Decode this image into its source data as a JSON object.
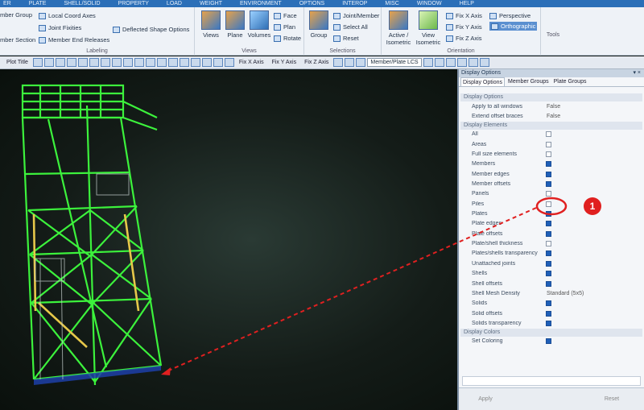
{
  "menubar": [
    "ER",
    "PLATE",
    "SHELL/SOLID",
    "PROPERTY",
    "LOAD",
    "WEIGHT",
    "ENVIRONMENT",
    "OPTIONS",
    "INTEROP",
    "MISC",
    "WINDOW",
    "HELP"
  ],
  "ribbon": {
    "labeling": {
      "items": [
        "mber Group",
        "Local Coord Axes",
        "Joint Fixities",
        "mber Section",
        "Member End Releases",
        "Deflected Shape Options"
      ],
      "group_label": "Labeling"
    },
    "views": {
      "buttons": [
        "Views",
        "Plane",
        "Volumes"
      ],
      "small": [
        "Face",
        "Plan",
        "Rotate"
      ],
      "group_label": "Views"
    },
    "selections": {
      "button": "Group",
      "small": [
        "Joint/Member",
        "Select All",
        "Reset"
      ],
      "group_label": "Selections"
    },
    "orientation": {
      "buttons": [
        "Active / Isometric",
        "View Isometric"
      ],
      "small": [
        "Fix X Axis",
        "Fix Y Axis",
        "Fix Z Axis"
      ],
      "projection": [
        "Perspective",
        "Orthographic"
      ],
      "group_label": "Orientation"
    },
    "tools": {
      "group_label": "Tools"
    }
  },
  "toolbar": {
    "plot_title": "Plot Title",
    "fix": [
      "Fix X Axis",
      "Fix Y Axis",
      "Fix Z Axis"
    ],
    "combo": "Member/Plate LCS"
  },
  "panel": {
    "title": "Display Options",
    "pin": "▾ ×",
    "tabs": [
      "Display Options",
      "Member Groups",
      "Plate Groups"
    ],
    "sections": {
      "options": "Display Options",
      "elements": "Display Elements",
      "colors": "Display Colors"
    },
    "options_rows": [
      {
        "name": "Apply to all windows",
        "value": "False"
      },
      {
        "name": "Extend offset braces",
        "value": "False"
      }
    ],
    "element_rows": [
      {
        "name": "All",
        "checked": false
      },
      {
        "name": "Areas",
        "checked": false
      },
      {
        "name": "Full size elements",
        "checked": false
      },
      {
        "name": "Members",
        "checked": true
      },
      {
        "name": "Member edges",
        "checked": true
      },
      {
        "name": "Member offsets",
        "checked": true
      },
      {
        "name": "Panels",
        "checked": false
      },
      {
        "name": "Piles",
        "checked": false
      },
      {
        "name": "Plates",
        "checked": true
      },
      {
        "name": "Plate edges",
        "checked": true
      },
      {
        "name": "Plate offsets",
        "checked": true
      },
      {
        "name": "Plate/shell thickness",
        "checked": false
      },
      {
        "name": "Plates/shells transparency",
        "checked": true
      },
      {
        "name": "Unattached joints",
        "checked": true
      },
      {
        "name": "Shells",
        "checked": true
      },
      {
        "name": "Shell offsets",
        "checked": true
      }
    ],
    "mesh_row": {
      "name": "Shell Mesh Density",
      "value": "Standard (5x5)"
    },
    "solid_rows": [
      {
        "name": "Solids",
        "checked": true
      },
      {
        "name": "Solid offsets",
        "checked": true
      },
      {
        "name": "Solids transparency",
        "checked": true
      }
    ],
    "color_rows": [
      {
        "name": "Set Coloring",
        "checked": true
      }
    ],
    "apply": "Apply",
    "reset": "Reset"
  },
  "annotation": {
    "number": "1",
    "circle_color": "#e02020",
    "arrow_color": "#e02020"
  },
  "colors": {
    "member": "#3cf23c",
    "highlight": "#e6c84a",
    "accent": "#1f5fb8"
  }
}
